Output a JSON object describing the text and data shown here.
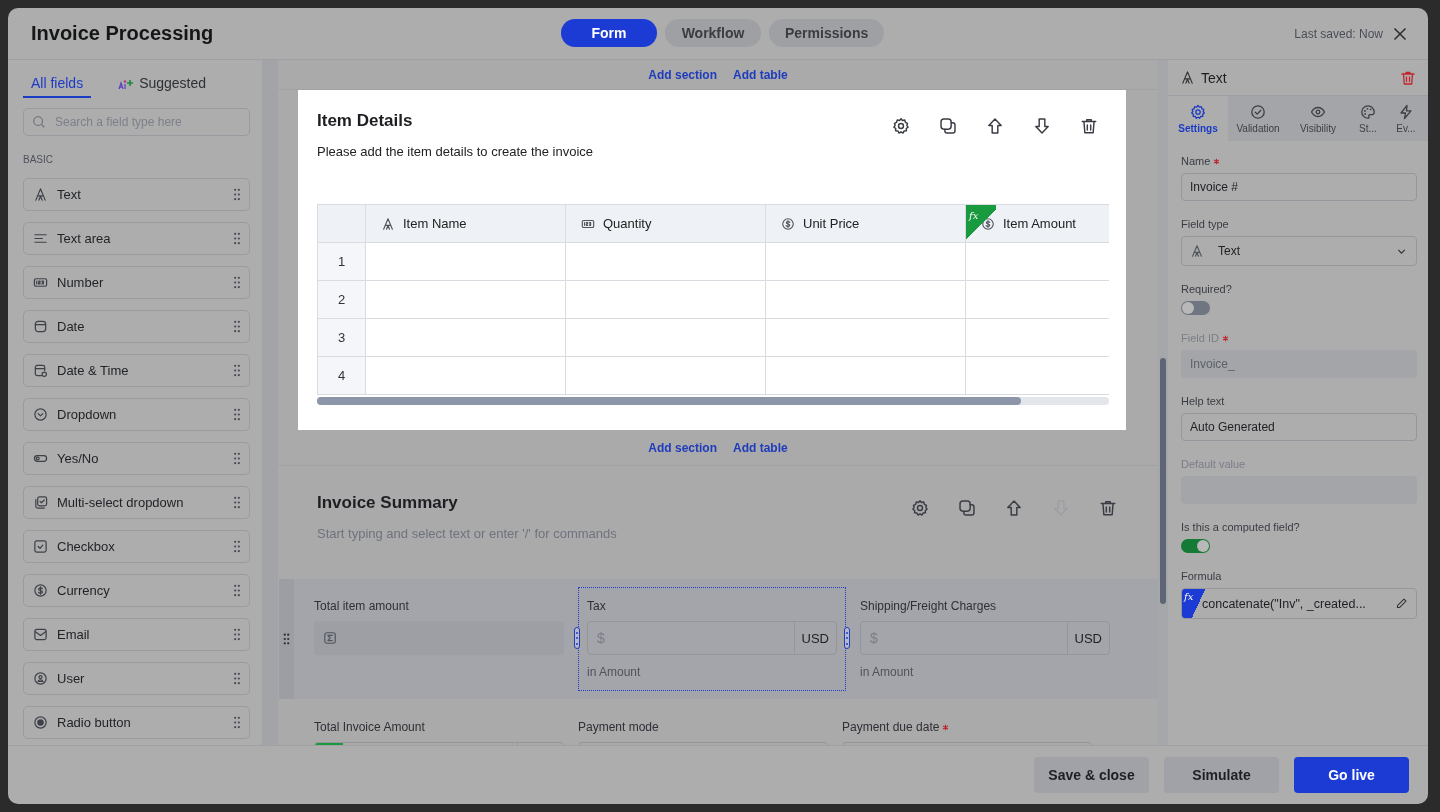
{
  "window": {
    "title": "Invoice Processing",
    "last_saved": "Last saved: Now"
  },
  "view_tabs": [
    {
      "label": "Form",
      "selected": true
    },
    {
      "label": "Workflow",
      "selected": false
    },
    {
      "label": "Permissions",
      "selected": false
    }
  ],
  "palette": {
    "tabs": [
      {
        "label": "All fields",
        "selected": true,
        "kind": "plain"
      },
      {
        "label": "Suggested",
        "selected": false,
        "kind": "ai"
      }
    ],
    "search": {
      "placeholder": "Search a field type here"
    },
    "group": "BASIC",
    "items": [
      {
        "label": "Text",
        "kind": "text"
      },
      {
        "label": "Text area",
        "kind": "textarea"
      },
      {
        "label": "Number",
        "kind": "number"
      },
      {
        "label": "Date",
        "kind": "date"
      },
      {
        "label": "Date & Time",
        "kind": "datetime"
      },
      {
        "label": "Dropdown",
        "kind": "dropdown"
      },
      {
        "label": "Yes/No",
        "kind": "yesno"
      },
      {
        "label": "Multi-select dropdown",
        "kind": "multiselect"
      },
      {
        "label": "Checkbox",
        "kind": "checkbox"
      },
      {
        "label": "Currency",
        "kind": "currency"
      },
      {
        "label": "Email",
        "kind": "email"
      },
      {
        "label": "User",
        "kind": "user"
      },
      {
        "label": "Radio button",
        "kind": "radio"
      }
    ]
  },
  "canvas": {
    "add_links_top": [
      "Add section",
      "Add table"
    ],
    "item_section": {
      "title": "Item Details",
      "description": "Please add the item details to create the invoice",
      "toolbar": [
        {
          "kind": "settings",
          "disabled": false
        },
        {
          "kind": "duplicate",
          "disabled": false
        },
        {
          "kind": "up",
          "disabled": false
        },
        {
          "kind": "down",
          "disabled": false
        },
        {
          "kind": "delete",
          "disabled": false
        }
      ],
      "table": {
        "columns": [
          {
            "label": "Item Name",
            "kind": "text",
            "computed": false
          },
          {
            "label": "Quantity",
            "kind": "number",
            "computed": false
          },
          {
            "label": "Unit Price",
            "kind": "currency",
            "computed": false
          },
          {
            "label": "Item Amount",
            "kind": "currency",
            "computed": true,
            "badge": "fx"
          }
        ],
        "rows": [
          "1",
          "2",
          "3",
          "4"
        ]
      }
    },
    "add_links_mid": [
      "Add section",
      "Add table"
    ],
    "summary": {
      "title": "Invoice Summary",
      "placeholder": "Start typing and select text or enter '/' for commands",
      "toolbar": [
        {
          "kind": "settings",
          "disabled": false
        },
        {
          "kind": "duplicate",
          "disabled": false
        },
        {
          "kind": "up",
          "disabled": false
        },
        {
          "kind": "down",
          "disabled": true
        },
        {
          "kind": "delete",
          "disabled": false
        }
      ],
      "fields": [
        {
          "kind": "sum",
          "label": "Total item amount",
          "selected": false
        },
        {
          "kind": "currency",
          "label": "Tax",
          "placeholder": "$",
          "unit": "USD",
          "help": "in Amount",
          "selected": true
        },
        {
          "kind": "currency",
          "label": "Shipping/Freight Charges",
          "placeholder": "$",
          "unit": "USD",
          "help": "in Amount",
          "selected": false
        }
      ],
      "fields_row2": [
        {
          "kind": "formula_currency",
          "label": "Total Invoice Amount",
          "required": false
        },
        {
          "kind": "plain",
          "label": "Payment mode",
          "required": false
        },
        {
          "kind": "plain",
          "label": "Payment due date",
          "required": true
        }
      ]
    }
  },
  "properties": {
    "title": "Text",
    "tabs": [
      {
        "label": "Settings",
        "kind": "settings",
        "selected": true
      },
      {
        "label": "Validation",
        "kind": "validation",
        "selected": false
      },
      {
        "label": "Visibility",
        "kind": "visibility",
        "selected": false
      },
      {
        "label": "St...",
        "kind": "style",
        "selected": false
      },
      {
        "label": "Ev...",
        "kind": "events",
        "selected": false
      }
    ],
    "fields": [
      {
        "kind": "input",
        "label": "Name",
        "required": true,
        "disabled": false,
        "value": "Invoice #"
      },
      {
        "kind": "select",
        "label": "Field type",
        "required": false,
        "disabled": false,
        "value": "Text"
      },
      {
        "kind": "toggle",
        "label": "Required?",
        "on": false
      },
      {
        "kind": "input",
        "label": "Field ID",
        "required": true,
        "disabled": true,
        "value": "Invoice_"
      },
      {
        "kind": "input",
        "label": "Help text",
        "required": false,
        "disabled": false,
        "value": "Auto Generated"
      },
      {
        "kind": "input",
        "label": "Default value",
        "required": false,
        "disabled": true
      },
      {
        "kind": "toggle",
        "label": "Is this a computed field?",
        "on": true
      },
      {
        "kind": "formula",
        "label": "Formula",
        "badge": "fx",
        "value": "concatenate(\"Inv\", _created..."
      }
    ]
  },
  "footer": {
    "buttons": [
      {
        "label": "Save & close",
        "kind": "secondary"
      },
      {
        "label": "Simulate",
        "kind": "secondary"
      },
      {
        "label": "Go live",
        "kind": "primary"
      }
    ]
  }
}
